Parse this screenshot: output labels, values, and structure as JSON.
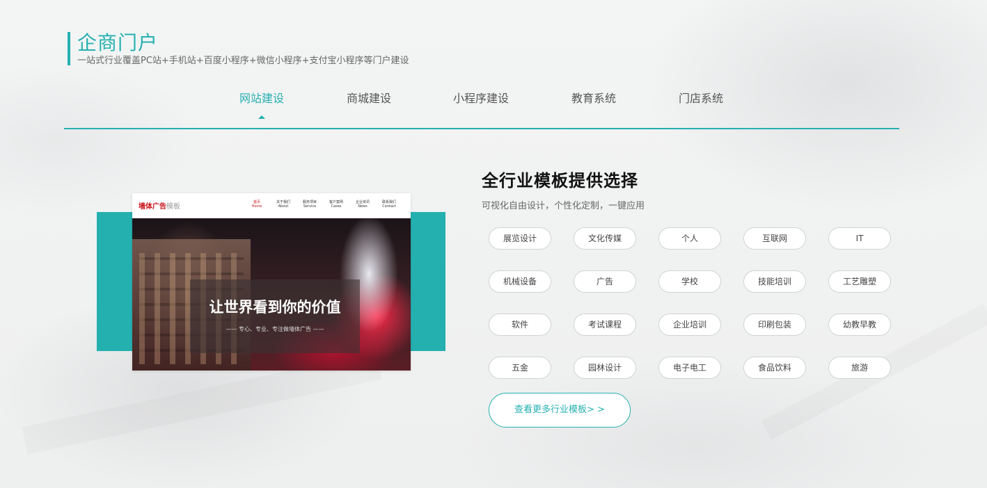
{
  "header": {
    "title": "企商门户",
    "subtitle": "一站式行业覆盖PC站+手机站+百度小程序+微信小程序+支付宝小程序等门户建设"
  },
  "tabs": [
    {
      "label": "网站建设",
      "active": true
    },
    {
      "label": "商城建设",
      "active": false
    },
    {
      "label": "小程序建设",
      "active": false
    },
    {
      "label": "教育系统",
      "active": false
    },
    {
      "label": "门店系统",
      "active": false
    }
  ],
  "preview": {
    "logo_red": "墙体广告",
    "logo_gray": "模板",
    "menu": [
      {
        "cn": "首页",
        "en": "Home",
        "active": true
      },
      {
        "cn": "关于我们",
        "en": "About",
        "active": false
      },
      {
        "cn": "服务项目",
        "en": "Service",
        "active": false
      },
      {
        "cn": "客户案例",
        "en": "Cases",
        "active": false
      },
      {
        "cn": "企业资讯",
        "en": "News",
        "active": false
      },
      {
        "cn": "联系我们",
        "en": "Contact",
        "active": false
      }
    ],
    "headline": "让世界看到你的价值",
    "subline": "——  专心、专业、专注做墙体广告  ——"
  },
  "section": {
    "title": "全行业模板提供选择",
    "subtitle": "可视化自由设计，个性化定制，一键应用"
  },
  "tags": [
    [
      "展览设计",
      "文化传媒",
      "个人",
      "互联网",
      "IT"
    ],
    [
      "机械设备",
      "广告",
      "学校",
      "技能培训",
      "工艺雕塑"
    ],
    [
      "软件",
      "考试课程",
      "企业培训",
      "印刷包装",
      "幼教早教"
    ],
    [
      "五金",
      "园林设计",
      "电子电工",
      "食品饮料",
      "旅游"
    ]
  ],
  "more_button": "查看更多行业模板> >",
  "colors": {
    "accent": "#25b0b0",
    "preview_logo": "#c8161d"
  }
}
